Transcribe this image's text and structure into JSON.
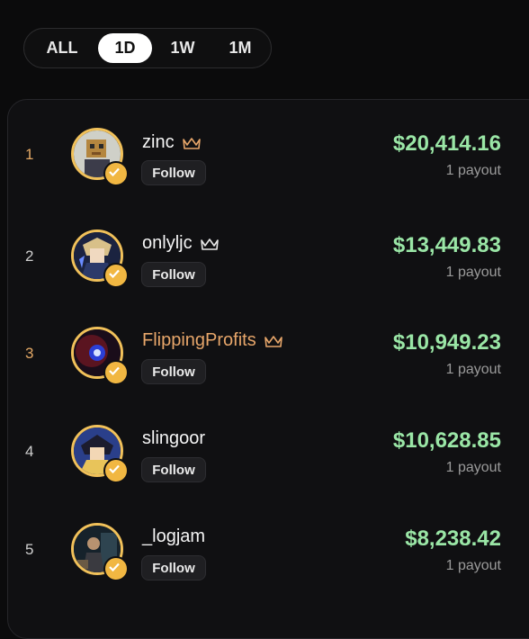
{
  "tabs": [
    {
      "label": "ALL",
      "active": false
    },
    {
      "label": "1D",
      "active": true
    },
    {
      "label": "1W",
      "active": false
    },
    {
      "label": "1M",
      "active": false
    }
  ],
  "follow_label": "Follow",
  "leaderboard": [
    {
      "rank": "1",
      "name": "zinc",
      "amount": "$20,414.16",
      "payouts": "1 payout",
      "avatar": "pixel-portrait-avatar"
    },
    {
      "rank": "2",
      "name": "onlyljc",
      "amount": "$13,449.83",
      "payouts": "1 payout",
      "avatar": "anime-character-avatar"
    },
    {
      "rank": "3",
      "name": "FlippingProfits",
      "amount": "$10,949.23",
      "payouts": "1 payout",
      "avatar": "glowing-eye-avatar"
    },
    {
      "rank": "4",
      "name": "slingoor",
      "amount": "$10,628.85",
      "payouts": "1 payout",
      "avatar": "anime-character-avatar"
    },
    {
      "rank": "5",
      "name": "_logjam",
      "amount": "$8,238.42",
      "payouts": "1 payout",
      "avatar": "figure-portrait-avatar"
    }
  ],
  "colors": {
    "background": "#0b0b0c",
    "amount": "#9ae6a6",
    "rank_highlight": "#e3a865",
    "avatar_ring": "#f1c15a",
    "badge": "#f1b742"
  }
}
